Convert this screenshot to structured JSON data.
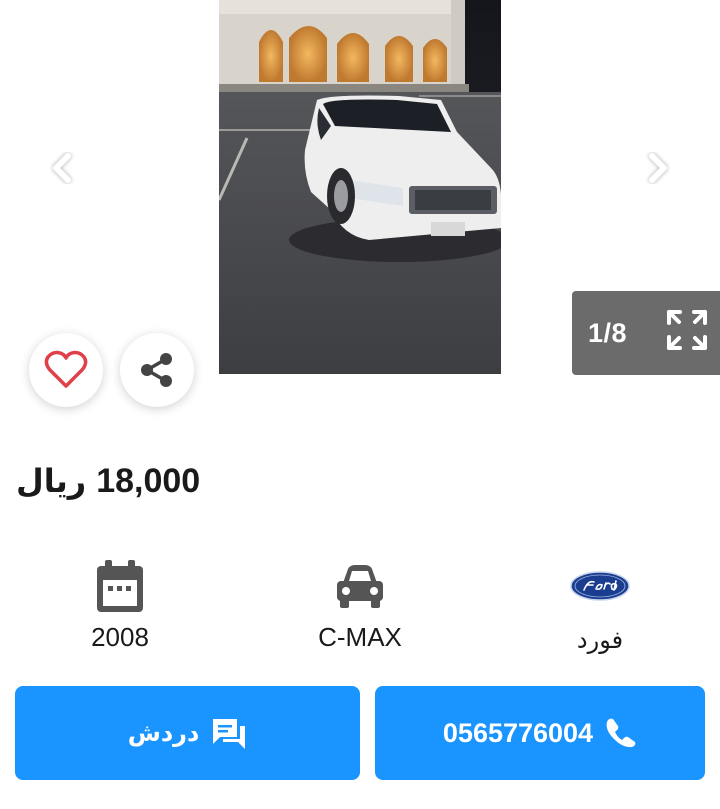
{
  "gallery": {
    "counter": "1/8",
    "icons": {
      "prev": "chevron-left-icon",
      "next": "chevron-right-icon",
      "expand": "fullscreen-icon",
      "favorite": "heart-icon",
      "share": "share-icon"
    }
  },
  "listing": {
    "price_value": "18,000",
    "price_currency": "ريال"
  },
  "specs": {
    "year": "2008",
    "model": "C-MAX",
    "make": "فورد"
  },
  "actions": {
    "chat_label": "دردش",
    "phone": "0565776004"
  },
  "colors": {
    "accent": "#1a94ff",
    "counter_bg": "#6b6b6b",
    "heart": "#e0404a"
  }
}
